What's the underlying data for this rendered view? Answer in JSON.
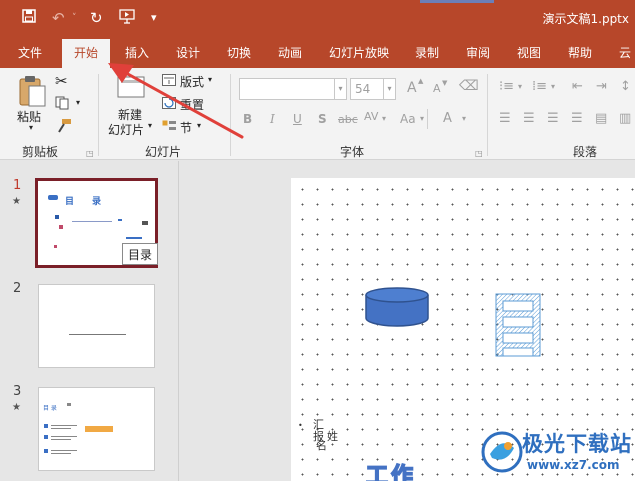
{
  "window": {
    "title": "演示文稿1.pptx",
    "accent_color": "#b7472a",
    "quick_access": [
      "save-icon",
      "undo-icon",
      "redo-icon",
      "slideshow-icon",
      "customize-icon"
    ]
  },
  "tabs": [
    "文件",
    "开始",
    "插入",
    "设计",
    "切换",
    "动画",
    "幻灯片放映",
    "录制",
    "审阅",
    "视图",
    "帮助",
    "云"
  ],
  "active_tab": "开始",
  "ribbon": {
    "clipboard": {
      "paste_label": "粘贴",
      "group_label": "剪贴板"
    },
    "slides": {
      "new_slide_line1": "新建",
      "new_slide_line2": "幻灯片",
      "layout_label": "版式",
      "reset_label": "重置",
      "section_label": "节",
      "group_label": "幻灯片"
    },
    "font": {
      "font_size": "54",
      "group_label": "字体",
      "bold": "B",
      "italic": "I",
      "underline": "U",
      "shadow": "S",
      "strike": "abc",
      "case": "Aa",
      "grow": "A",
      "shrink": "A"
    },
    "paragraph": {
      "group_label": "段落"
    }
  },
  "thumbnails": [
    {
      "number": "1",
      "has_star": true,
      "title": "目　　录",
      "selected": true
    },
    {
      "number": "2",
      "has_star": false,
      "selected": false
    },
    {
      "number": "3",
      "has_star": true,
      "title": "目 录",
      "selected": false
    }
  ],
  "tooltip": "目录",
  "slide": {
    "text_fragment_1": "汇报",
    "text_fragment_2": "姓",
    "text_fragment_3": "名",
    "bottom_text": "工作"
  },
  "watermark": {
    "name": "极光下载站",
    "url": "www.xz7.com"
  }
}
